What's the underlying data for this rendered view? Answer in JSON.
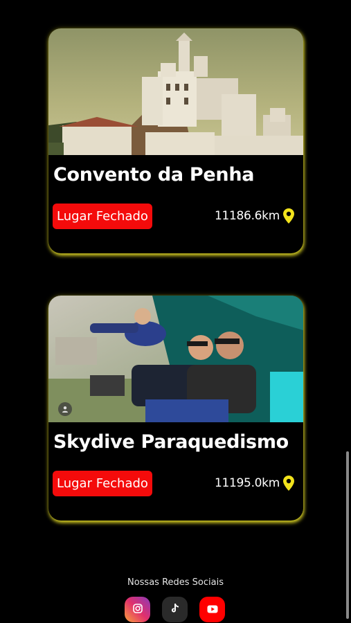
{
  "places": [
    {
      "title": "Convento da Penha",
      "status": "Lugar Fechado",
      "distance": "11186.6km",
      "photo": "convent-on-hill-photo"
    },
    {
      "title": "Skydive Paraquedismo",
      "status": "Lugar Fechado",
      "distance": "11195.0km",
      "photo": "skydivers-in-plane-photo"
    }
  ],
  "footer": {
    "title": "Nossas Redes Sociais",
    "socials": [
      "instagram-icon",
      "tiktok-icon",
      "youtube-icon"
    ]
  },
  "colors": {
    "background": "#000000",
    "card_glow": "#eae228",
    "status_badge": "#f40b0b",
    "pin": "#f2e31c"
  }
}
